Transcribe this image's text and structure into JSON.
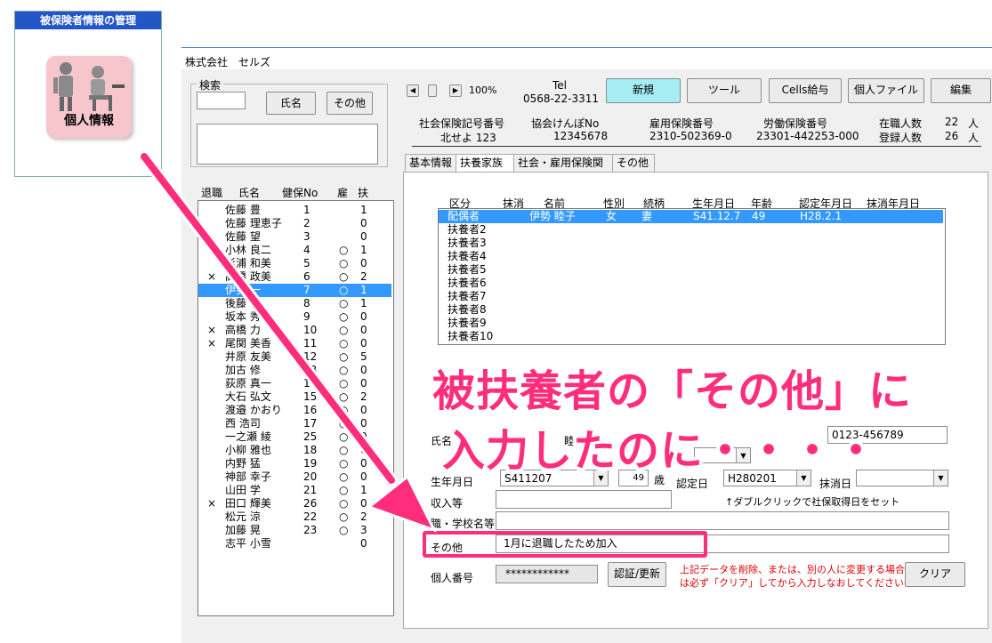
{
  "nav": {
    "title": "被保険者情報の管理",
    "tile_label": "個人情報"
  },
  "company": "株式会社　セルズ",
  "search": {
    "caption": "検索",
    "name_btn": "氏名",
    "other_btn": "その他"
  },
  "employee_list": {
    "headers": [
      "退職",
      "氏名",
      "健保No",
      "雇",
      "扶"
    ],
    "rows": [
      {
        "ret": "",
        "name": "佐藤 豊",
        "no": "1",
        "emp": "",
        "dep": "1"
      },
      {
        "ret": "",
        "name": "佐藤 理恵子",
        "no": "2",
        "emp": "",
        "dep": "0"
      },
      {
        "ret": "",
        "name": "佐藤 望",
        "no": "3",
        "emp": "",
        "dep": "0"
      },
      {
        "ret": "",
        "name": "小林 良二",
        "no": "4",
        "emp": "○",
        "dep": "1"
      },
      {
        "ret": "",
        "name": "杉浦 和美",
        "no": "5",
        "emp": "○",
        "dep": "0"
      },
      {
        "ret": "×",
        "name": "高橋 政美",
        "no": "6",
        "emp": "○",
        "dep": "2"
      },
      {
        "ret": "",
        "name": "伊勢 一",
        "no": "7",
        "emp": "○",
        "dep": "1"
      },
      {
        "ret": "",
        "name": "後藤 智",
        "no": "8",
        "emp": "○",
        "dep": "1"
      },
      {
        "ret": "",
        "name": "坂本 秀樹",
        "no": "9",
        "emp": "○",
        "dep": "0"
      },
      {
        "ret": "×",
        "name": "高橋 力",
        "no": "10",
        "emp": "○",
        "dep": "0"
      },
      {
        "ret": "×",
        "name": "尾関 美香",
        "no": "11",
        "emp": "○",
        "dep": "0"
      },
      {
        "ret": "",
        "name": "井原 友美",
        "no": "12",
        "emp": "○",
        "dep": "5"
      },
      {
        "ret": "",
        "name": "加古 修",
        "no": "13",
        "emp": "○",
        "dep": "0"
      },
      {
        "ret": "",
        "name": "荻原 真一",
        "no": "14",
        "emp": "○",
        "dep": "0"
      },
      {
        "ret": "",
        "name": "大石 弘文",
        "no": "15",
        "emp": "○",
        "dep": "2"
      },
      {
        "ret": "",
        "name": "渡邉 かおり",
        "no": "16",
        "emp": "○",
        "dep": "0"
      },
      {
        "ret": "",
        "name": "西 浩司",
        "no": "17",
        "emp": "○",
        "dep": "0"
      },
      {
        "ret": "",
        "name": "一之瀬 綾",
        "no": "25",
        "emp": "○",
        "dep": "0"
      },
      {
        "ret": "",
        "name": "小柳 雅也",
        "no": "18",
        "emp": "○",
        "dep": "0"
      },
      {
        "ret": "",
        "name": "内野 猛",
        "no": "19",
        "emp": "○",
        "dep": "0"
      },
      {
        "ret": "",
        "name": "神部 幸子",
        "no": "20",
        "emp": "○",
        "dep": "0"
      },
      {
        "ret": "",
        "name": "山田 学",
        "no": "21",
        "emp": "○",
        "dep": "1"
      },
      {
        "ret": "×",
        "name": "田口 輝美",
        "no": "26",
        "emp": "○",
        "dep": "0"
      },
      {
        "ret": "",
        "name": "松元 涼",
        "no": "22",
        "emp": "○",
        "dep": "2"
      },
      {
        "ret": "",
        "name": "加藤 晃",
        "no": "23",
        "emp": "○",
        "dep": "3"
      },
      {
        "ret": "",
        "name": "志平 小雪",
        "no": "",
        "emp": "",
        "dep": "0"
      }
    ],
    "selected_index": 6
  },
  "toolbar": {
    "zoom": "100%",
    "tel_label": "Tel",
    "tel_value": "0568-22-3311",
    "new_btn": "新規",
    "tool_btn": "ツール",
    "payroll_btn": "Cells給与",
    "file_btn": "個人ファイル",
    "edit_btn": "編集"
  },
  "info": {
    "shaho_label": "社会保険記号番号",
    "shaho_value": "北せよ 123",
    "kyokai_label": "協会けんぽNo",
    "kyokai_value": "12345678",
    "koyo_label": "雇用保険番号",
    "koyo_value": "2310-502369-0",
    "rodo_label": "労働保険番号",
    "rodo_value": "23301-442253-000",
    "active_label": "在職人数",
    "active_value": "22",
    "active_unit": "人",
    "reg_label": "登録人数",
    "reg_value": "26",
    "reg_unit": "人"
  },
  "tabs": [
    "基本情報",
    "扶養家族",
    "社会・雇用保険関係",
    "その他"
  ],
  "dependents": {
    "headers": [
      "区分",
      "抹消",
      "名前",
      "性別",
      "続柄",
      "生年月日",
      "年齢",
      "認定年月日",
      "抹消年月日"
    ],
    "rows": [
      {
        "kubun": "配偶者",
        "name": "伊勢 睦子",
        "sex": "女",
        "rel": "妻",
        "birth": "S41.12.7",
        "age": "49",
        "cert": "H28.2.1"
      },
      {
        "kubun": "扶養者2"
      },
      {
        "kubun": "扶養者3"
      },
      {
        "kubun": "扶養者4"
      },
      {
        "kubun": "扶養者5"
      },
      {
        "kubun": "扶養者6"
      },
      {
        "kubun": "扶養者7"
      },
      {
        "kubun": "扶養者8"
      },
      {
        "kubun": "扶養者9"
      },
      {
        "kubun": "扶養者10"
      }
    ]
  },
  "detail": {
    "name_label": "氏名",
    "name_value": "睦子",
    "phone_value": "0123-456789",
    "birth_label": "生年月日",
    "birth_value": "S411207",
    "age_value": "49",
    "age_unit": "歳",
    "cert_label": "認定日",
    "cert_value": "H280201",
    "delete_label": "抹消日",
    "income_label": "収入等",
    "hint": "↑ダブルクリックで社保取得日をセット",
    "job_label": "職・学校名等",
    "other_label": "その他",
    "other_value": "1月に退職したため加入",
    "mynumber_label": "個人番号",
    "mynumber_value": "************",
    "auth_btn": "認証/更新",
    "warn_line1": "上記データを削除、または、別の人に変更する場合",
    "warn_line2": "は必ず「クリア」してから入力しなおしてください⇒⇒",
    "clear_btn": "クリア"
  },
  "annotation": {
    "line1": "被扶養者の「その他」に",
    "line2": "入力したのに・・・・"
  },
  "colors": {
    "accent_pink": "#ff2d7c",
    "selection": "#3399ff",
    "new_btn": "#a6ecf3",
    "nav_header": "#2255c6"
  }
}
